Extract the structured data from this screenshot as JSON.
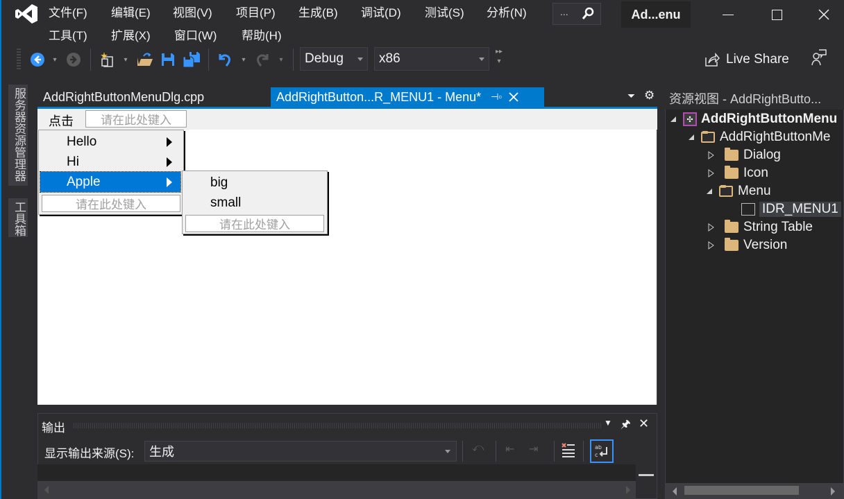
{
  "window": {
    "title_short": "Ad...enu",
    "search_label": "..."
  },
  "menu": {
    "row1": [
      "文件(F)",
      "编辑(E)",
      "视图(V)",
      "项目(P)",
      "生成(B)",
      "调试(D)",
      "测试(S)",
      "分析(N)"
    ],
    "row2": [
      "工具(T)",
      "扩展(X)",
      "窗口(W)",
      "帮助(H)"
    ]
  },
  "toolbar": {
    "configuration": "Debug",
    "platform": "x86",
    "live_share_label": "Live Share"
  },
  "side_tabs": [
    "服务器资源管理器",
    "工具箱"
  ],
  "document_tabs": [
    {
      "label": "AddRightButtonMenuDlg.cpp",
      "active": false
    },
    {
      "label": "AddRightButton...R_MENU1 - Menu*",
      "active": true
    }
  ],
  "menu_editor": {
    "top_item": "点击",
    "type_here": "请在此处键入",
    "popup_items": [
      {
        "label": "Hello",
        "has_submenu": true,
        "selected": false
      },
      {
        "label": "Hi",
        "has_submenu": true,
        "selected": false
      },
      {
        "label": "Apple",
        "has_submenu": true,
        "selected": true
      }
    ],
    "submenu_items": [
      "big",
      "small"
    ]
  },
  "resource_view": {
    "title": "资源视图 - AddRightButto...",
    "tree": [
      {
        "label": "AddRightButtonMenu",
        "level": 0,
        "expanded": true,
        "bold": true,
        "icon": "project-icon"
      },
      {
        "label": "AddRightButtonMe",
        "level": 1,
        "expanded": true,
        "icon": "folder-open-icon"
      },
      {
        "label": "Dialog",
        "level": 2,
        "expanded": false,
        "icon": "folder-icon"
      },
      {
        "label": "Icon",
        "level": 2,
        "expanded": false,
        "icon": "folder-icon"
      },
      {
        "label": "Menu",
        "level": 2,
        "expanded": true,
        "icon": "folder-open-icon"
      },
      {
        "label": "IDR_MENU1",
        "level": 3,
        "selected": true,
        "icon": "menu-resource-icon"
      },
      {
        "label": "String Table",
        "level": 2,
        "expanded": false,
        "icon": "folder-icon"
      },
      {
        "label": "Version",
        "level": 2,
        "expanded": false,
        "icon": "folder-icon"
      }
    ]
  },
  "output": {
    "title": "输出",
    "source_label": "显示输出来源(S):",
    "source_value": "生成"
  },
  "colors": {
    "accent": "#007acc",
    "background": "#2d2d30",
    "panel": "#252526",
    "folder": "#dcb67a"
  }
}
